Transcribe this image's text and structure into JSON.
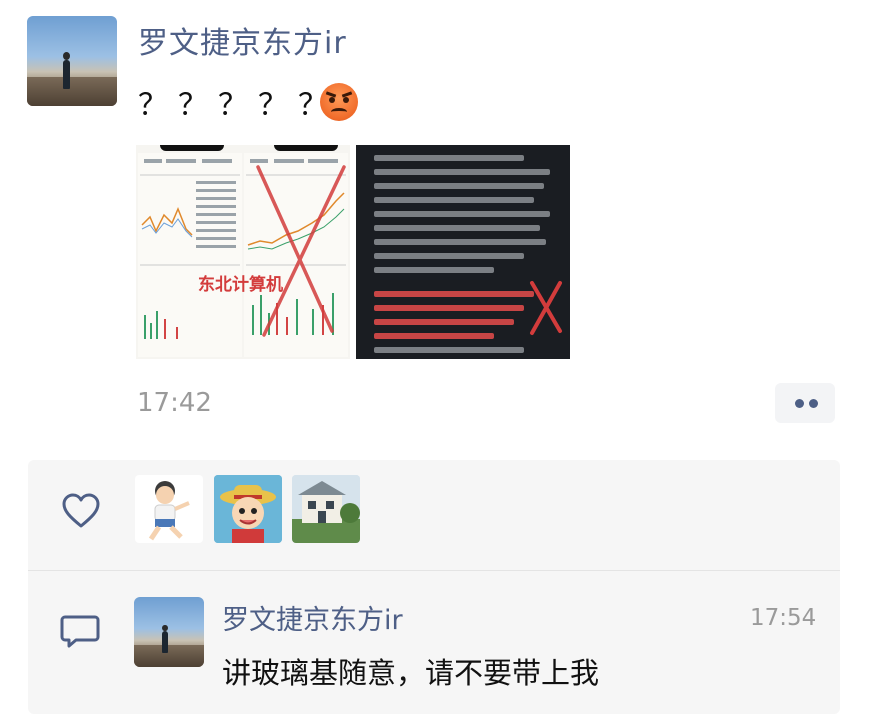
{
  "post": {
    "author": "罗文捷京东方ir",
    "text": "？？？？？",
    "emoji": "angry-face",
    "photos": [
      {
        "caption": "东北计算机"
      },
      {
        "caption": ""
      }
    ],
    "time": "17:42",
    "more_icon": "more-dots-icon"
  },
  "likes": {
    "icon": "heart-icon",
    "avatars": [
      "cartoon-boy-avatar",
      "straw-hat-avatar",
      "house-avatar"
    ]
  },
  "comments": [
    {
      "icon": "comment-icon",
      "author": "罗文捷京东方ir",
      "time": "17:54",
      "text": "讲玻璃基随意，请不要带上我"
    }
  ],
  "colors": {
    "name_blue": "#4e5f86",
    "panel_bg": "#f6f6f6",
    "timestamp_gray": "#9a9a9a",
    "strike_red": "#d33c3c"
  }
}
